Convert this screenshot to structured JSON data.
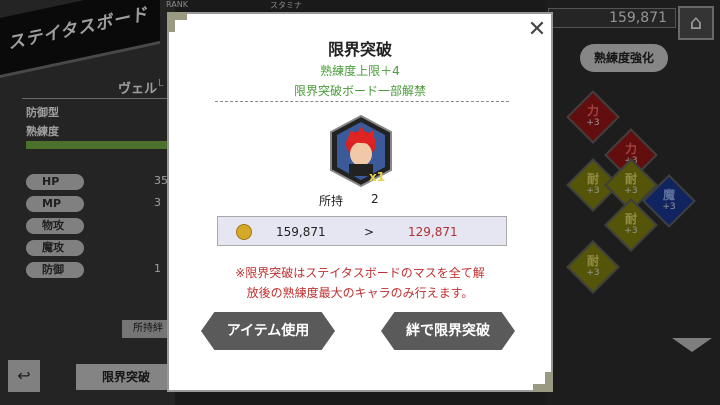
{
  "header": {
    "title": "ステイタスボード",
    "rank_label": "RANK",
    "stamina_label": "スタミナ",
    "gold": "159,871",
    "home_icon": "home-icon",
    "enhance_button": "熟練度強化"
  },
  "character": {
    "rank_char": "L",
    "name": "ヴェル",
    "type": "防御型",
    "proficiency_label": "熟練度",
    "stats": [
      {
        "label": "HP",
        "value": "35",
        "icon": "heart-icon"
      },
      {
        "label": "MP",
        "value": "3",
        "icon": "mp-icon"
      },
      {
        "label": "物攻",
        "value": "",
        "icon": "sword-icon"
      },
      {
        "label": "魔攻",
        "value": "",
        "icon": "wand-icon"
      },
      {
        "label": "防御",
        "value": "1",
        "icon": "shield-icon"
      }
    ],
    "owned_label": "所持絆"
  },
  "bottom": {
    "back_icon": "back-arrow-icon",
    "limit_tab": "限界突破"
  },
  "board": {
    "tiles": [
      {
        "label": "力",
        "bonus": "+3",
        "color": "#a01818"
      },
      {
        "label": "力",
        "bonus": "+3",
        "color": "#a01818"
      },
      {
        "label": "耐",
        "bonus": "+3",
        "color": "#8a8a10"
      },
      {
        "label": "耐",
        "bonus": "+3",
        "color": "#8a8a10"
      },
      {
        "label": "魔",
        "bonus": "+3",
        "color": "#1a3a9a"
      },
      {
        "label": "耐",
        "bonus": "+3",
        "color": "#8a8a10"
      },
      {
        "label": "耐",
        "bonus": "+3",
        "color": "#8a8a10"
      }
    ]
  },
  "modal": {
    "title": "限界突破",
    "sub1": "熟練度上限＋4",
    "sub2": "限界突破ボード一部解禁",
    "item_qty_badge": "x1",
    "owned_label": "所持",
    "owned_count": "2",
    "cost_from": "159,871",
    "cost_arrow": ">",
    "cost_to": "129,871",
    "note_line1": "※限界突破はステイタスボードのマスを全て解",
    "note_line2": "放後の熟練度最大のキャラのみ行えます。",
    "btn_item": "アイテム使用",
    "btn_limit": "絆で限界突破",
    "close_icon": "close-icon",
    "coin_icon": "coin-icon"
  }
}
